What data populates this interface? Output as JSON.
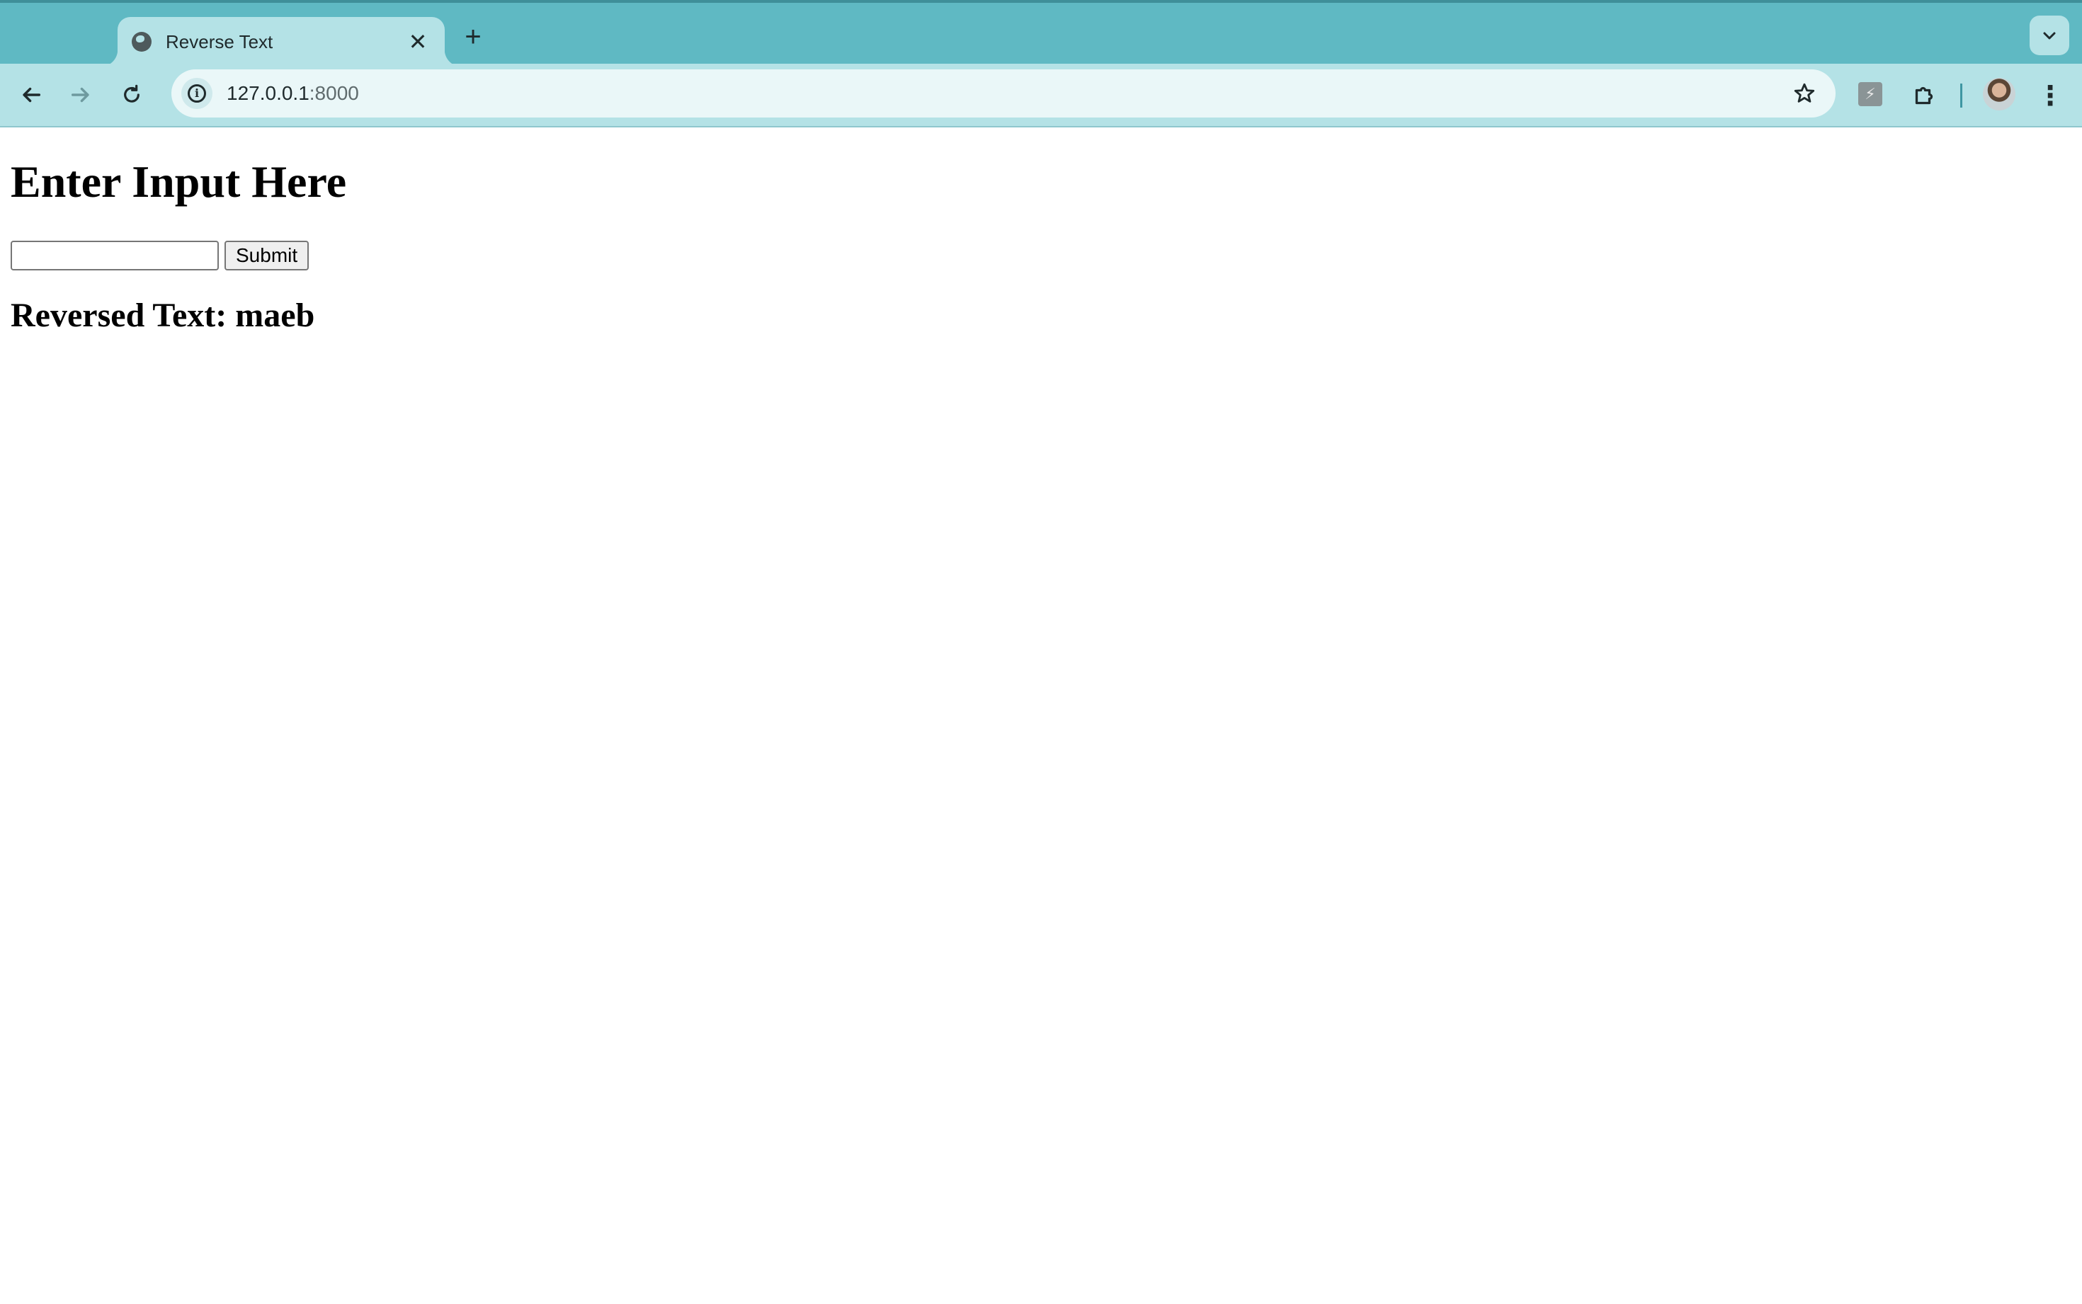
{
  "browser": {
    "tab": {
      "title": "Reverse Text"
    },
    "address": {
      "host": "127.0.0.1",
      "port": ":8000"
    },
    "colors": {
      "tabstrip": "#5fb9c3",
      "toolbar": "#b4e2e6"
    }
  },
  "page": {
    "heading": "Enter Input Here",
    "input": {
      "value": "",
      "placeholder": ""
    },
    "submit_label": "Submit",
    "result_label": "Reversed Text:",
    "result_value": "maeb"
  },
  "icons": [
    "globe-icon",
    "close-icon",
    "plus-icon",
    "chevron-down-icon",
    "back-arrow-icon",
    "forward-arrow-icon",
    "reload-icon",
    "info-icon",
    "star-icon",
    "extension-icon",
    "puzzle-icon",
    "avatar",
    "kebab-menu-icon"
  ]
}
